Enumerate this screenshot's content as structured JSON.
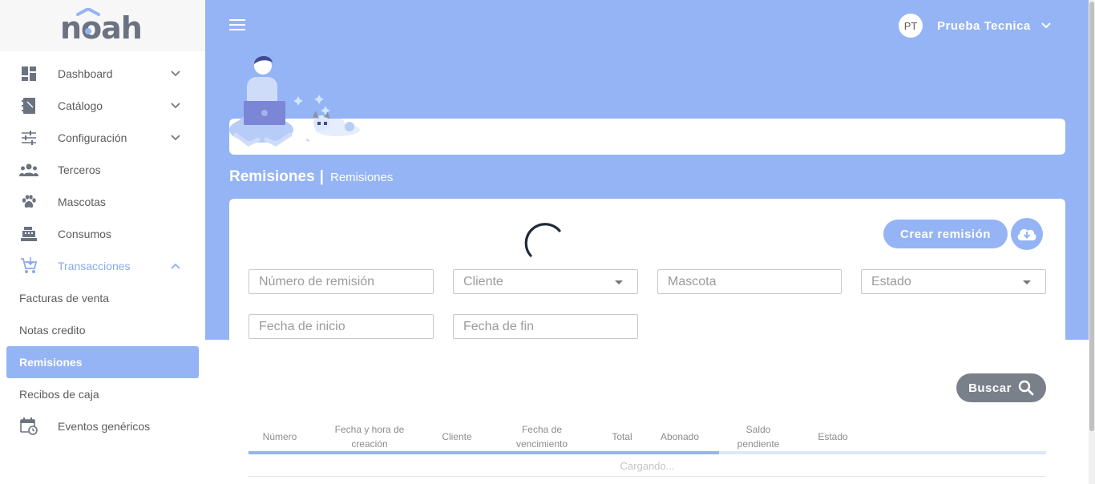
{
  "logo": {
    "text": "noah"
  },
  "sidebar": {
    "items": [
      {
        "label": "Dashboard",
        "icon": "dashboard-icon",
        "chevron": "down"
      },
      {
        "label": "Catálogo",
        "icon": "notebook-icon",
        "chevron": "down"
      },
      {
        "label": "Configuración",
        "icon": "sliders-icon",
        "chevron": "down"
      },
      {
        "label": "Terceros",
        "icon": "people-icon"
      },
      {
        "label": "Mascotas",
        "icon": "paw-icon"
      },
      {
        "label": "Consumos",
        "icon": "cash-register-icon"
      },
      {
        "label": "Transacciones",
        "icon": "cart-icon",
        "chevron": "up",
        "expanded": true
      }
    ],
    "subitems": [
      {
        "label": "Facturas de venta"
      },
      {
        "label": "Notas credito"
      },
      {
        "label": "Remisiones",
        "selected": true
      },
      {
        "label": "Recibos de caja"
      }
    ],
    "extra_item": {
      "label": "Eventos genéricos",
      "icon": "calendar-clock-icon"
    }
  },
  "header": {
    "user_initials": "PT",
    "user_name": "Prueba Tecnica"
  },
  "page": {
    "title": "Remisiones",
    "separator": "|",
    "breadcrumb": "Remisiones"
  },
  "actions": {
    "create_label": "Crear remisión",
    "search_label": "Buscar"
  },
  "filters": {
    "numero": {
      "placeholder": "Número de remisión"
    },
    "cliente": {
      "placeholder": "Cliente"
    },
    "mascota": {
      "placeholder": "Mascota"
    },
    "estado": {
      "placeholder": "Estado"
    },
    "fecha_inicio": {
      "placeholder": "Fecha de inicio"
    },
    "fecha_fin": {
      "placeholder": "Fecha de fin"
    }
  },
  "table": {
    "columns": [
      "Número",
      "Fecha y hora de creación",
      "Cliente",
      "Fecha de vencimiento",
      "Total",
      "Abonado",
      "Saldo pendiente",
      "Estado"
    ],
    "loading_text": "Cargando...",
    "progress": 0.59
  },
  "colors": {
    "accent": "#95b4f5",
    "search_button": "#7a808a",
    "text": "#5c5c5c"
  }
}
